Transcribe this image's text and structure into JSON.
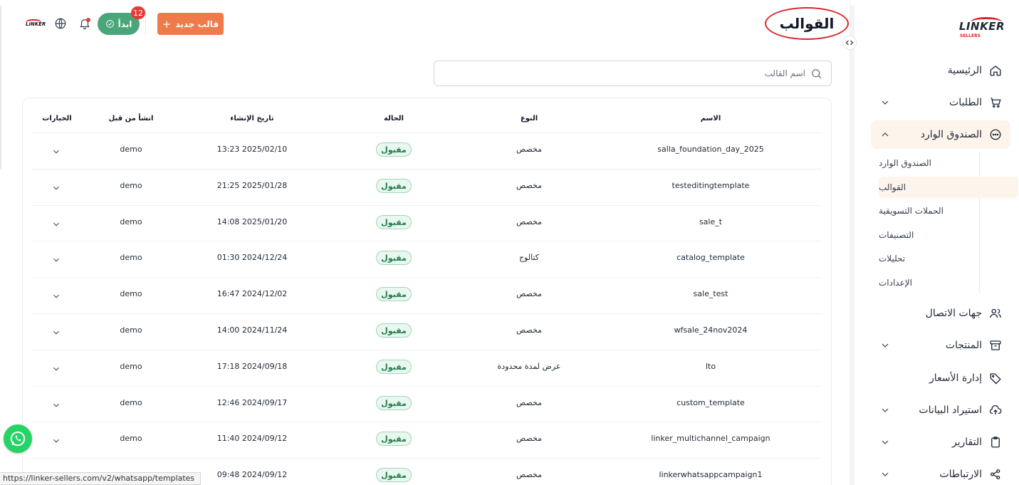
{
  "sidebar": {
    "logo_text": "LINKER",
    "logo_sub": "SELLERS",
    "items": [
      {
        "label": "الرئيسية",
        "icon": "home-icon"
      },
      {
        "label": "الطلبات",
        "icon": "cart-icon"
      },
      {
        "label": "الصندوق الوارد",
        "icon": "chat-icon"
      },
      {
        "label": "جهات الاتصال",
        "icon": "users-icon"
      },
      {
        "label": "المنتجات",
        "icon": "archive-icon"
      },
      {
        "label": "إدارة الأسعار",
        "icon": "tag-icon"
      },
      {
        "label": "استيراد البيانات",
        "icon": "upload-cloud-icon"
      },
      {
        "label": "التقارير",
        "icon": "clipboard-icon"
      },
      {
        "label": "الارتباطات",
        "icon": "share-icon"
      }
    ],
    "sub_items": [
      {
        "label": "الصندوق الوارد"
      },
      {
        "label": "القوالب"
      },
      {
        "label": "الحملات التسويقية"
      },
      {
        "label": "التصنيفات"
      },
      {
        "label": "تحليلات"
      },
      {
        "label": "الإعدادات"
      }
    ]
  },
  "header": {
    "title": "القوالب",
    "new_template_label": "قالب جديد",
    "start_label": "ابدأ",
    "notification_count": "12",
    "user_logo_text": "LiNKER"
  },
  "search": {
    "placeholder": "اسم القالب",
    "value": ""
  },
  "table": {
    "columns": [
      "الاسم",
      "النوع",
      "الحالة",
      "تاريخ الإنشاء",
      "انشأ من قبل",
      "الخيارات"
    ],
    "rows": [
      {
        "name": "salla_foundation_day_2025",
        "type": "مخصص",
        "status": "مقبول",
        "created": "13:23 2025/02/10",
        "by": "demo"
      },
      {
        "name": "testeditingtemplate",
        "type": "مخصص",
        "status": "مقبول",
        "created": "21:25 2025/01/28",
        "by": "demo"
      },
      {
        "name": "sale_t",
        "type": "مخصص",
        "status": "مقبول",
        "created": "14:08 2025/01/20",
        "by": "demo"
      },
      {
        "name": "catalog_template",
        "type": "كتالوج",
        "status": "مقبول",
        "created": "01:30 2024/12/24",
        "by": "demo"
      },
      {
        "name": "sale_test",
        "type": "مخصص",
        "status": "مقبول",
        "created": "16:47 2024/12/02",
        "by": "demo"
      },
      {
        "name": "wfsale_24nov2024",
        "type": "مخصص",
        "status": "مقبول",
        "created": "14:00 2024/11/24",
        "by": "demo"
      },
      {
        "name": "lto",
        "type": "عرض لمدة محدودة",
        "status": "مقبول",
        "created": "17:18 2024/09/18",
        "by": "demo"
      },
      {
        "name": "custom_template",
        "type": "مخصص",
        "status": "مقبول",
        "created": "12:46 2024/09/17",
        "by": "demo"
      },
      {
        "name": "linker_multichannel_campaign",
        "type": "مخصص",
        "status": "مقبول",
        "created": "11:40 2024/09/12",
        "by": "demo"
      },
      {
        "name": "linkerwhatsappcampaign1",
        "type": "مخصص",
        "status": "مقبول",
        "created": "09:48 2024/09/12",
        "by": ""
      }
    ]
  },
  "status_bar": {
    "url": "https://linker-sellers.com/v2/whatsapp/templates"
  },
  "colors": {
    "accent_orange": "#ef7a4a",
    "start_green": "#4aa57a",
    "badge_green": "#1f7a4c",
    "active_bg": "#fdf4ec",
    "title_circle": "#d62828"
  }
}
